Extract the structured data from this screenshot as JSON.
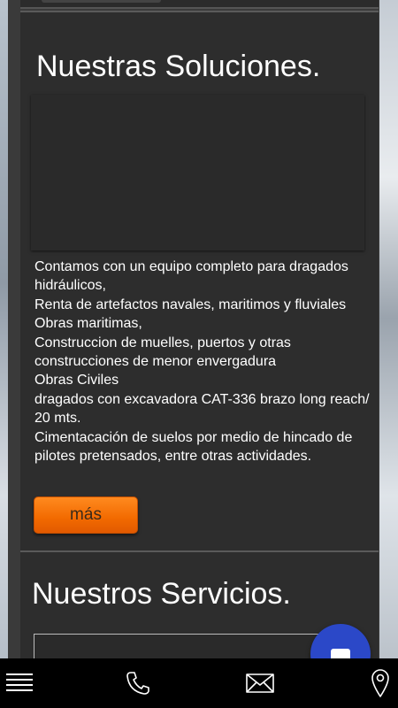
{
  "solutions": {
    "title": "Nuestras Soluciones.",
    "description_lines": [
      "Contamos con un equipo completo para dragados hidráulicos,",
      "Renta de  artefactos navales, maritimos y fluviales",
      "Obras maritimas,",
      "Construccion de muelles, puertos  y otras construcciones de menor envergadura",
      "Obras Civiles",
      "dragados con excavadora CAT-336 brazo long reach/ 20 mts.",
      "Cimentacación de suelos por medio de hincado de pilotes pretensados, entre otras actividades."
    ],
    "more_label": "más"
  },
  "services": {
    "title": "Nuestros Servicios."
  },
  "colors": {
    "accent_orange": "#f26a00",
    "chat_blue": "#2b48c8",
    "card_bg": "#2d2d2d",
    "bar_bg": "#000000"
  },
  "bottom_bar": {
    "icons": [
      "menu-icon",
      "phone-icon",
      "mail-icon",
      "location-icon"
    ]
  },
  "chat": {
    "icon": "chat-icon"
  }
}
